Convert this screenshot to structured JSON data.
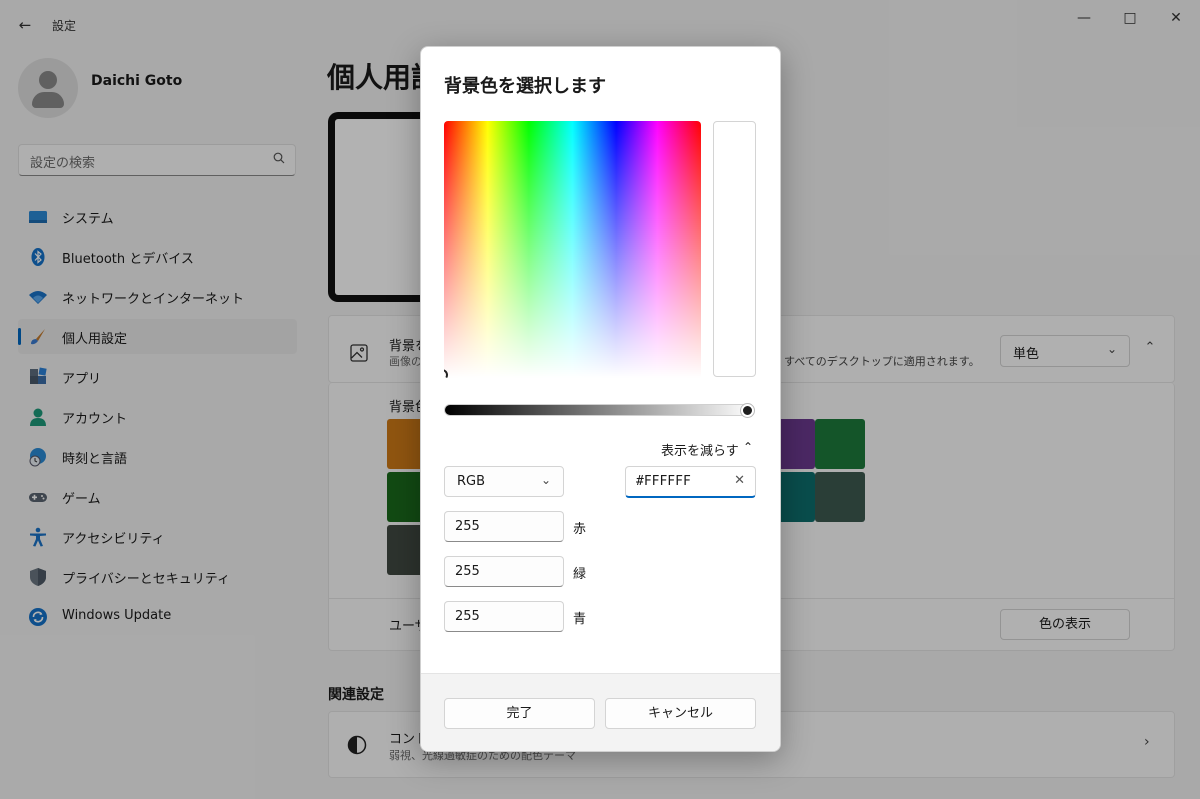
{
  "app": {
    "title": "設定",
    "back_icon": "back-arrow-icon",
    "window_controls": [
      "minimize",
      "maximize",
      "close"
    ]
  },
  "profile": {
    "name": "Daichi Goto"
  },
  "search": {
    "placeholder": "設定の検索"
  },
  "sidebar": {
    "items": [
      {
        "label": "システム",
        "icon": "system-icon"
      },
      {
        "label": "Bluetooth とデバイス",
        "icon": "bluetooth-icon"
      },
      {
        "label": "ネットワークとインターネット",
        "icon": "wifi-icon"
      },
      {
        "label": "個人用設定",
        "icon": "brush-icon",
        "active": true
      },
      {
        "label": "アプリ",
        "icon": "apps-icon"
      },
      {
        "label": "アカウント",
        "icon": "account-icon"
      },
      {
        "label": "時刻と言語",
        "icon": "time-language-icon"
      },
      {
        "label": "ゲーム",
        "icon": "gaming-icon"
      },
      {
        "label": "アクセシビリティ",
        "icon": "accessibility-icon"
      },
      {
        "label": "プライバシーとセキュリティ",
        "icon": "shield-icon"
      },
      {
        "label": "Windows Update",
        "icon": "update-icon"
      }
    ]
  },
  "main": {
    "title": "個人用設",
    "background_card": {
      "title": "背景を",
      "subtitle": "画像の",
      "subtitle_right": "すべてのデスクトップに適用されます。",
      "dropdown_value": "単色"
    },
    "colors_label": "背景色",
    "custom_color_label": "ユーザ",
    "view_colors_button": "色の表示",
    "swatches": [
      "#cf7a18",
      "#1b6e2c",
      "#6c3a90",
      "#1e7a3c",
      "#1a6a1c",
      "#0e6f6e",
      "#3d5a50",
      "#414a42"
    ],
    "related_title": "関連設定",
    "contrast_card": {
      "title": "コント",
      "subtitle": "弱視、光線過敏症のための配色テーマ"
    }
  },
  "dialog": {
    "title": "背景色を選択します",
    "show_less": "表示を減らす",
    "color_model": "RGB",
    "hex_value": "#FFFFFF",
    "selected_color": "#FFFFFF",
    "channels": [
      {
        "value": "255",
        "label": "赤"
      },
      {
        "value": "255",
        "label": "緑"
      },
      {
        "value": "255",
        "label": "青"
      }
    ],
    "done_button": "完了",
    "cancel_button": "キャンセル"
  }
}
